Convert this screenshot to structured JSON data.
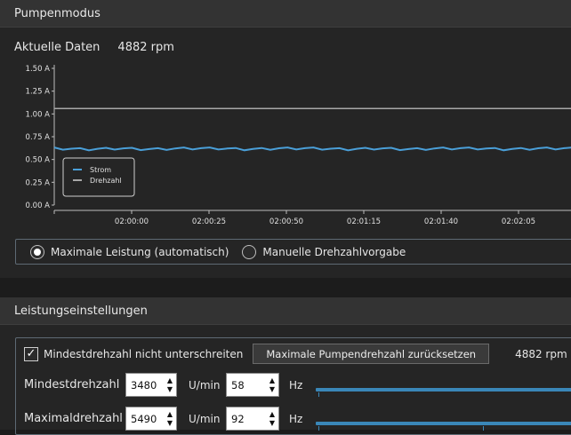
{
  "pump_panel": {
    "title": "Pumpenmodus",
    "current_label": "Aktuelle Daten",
    "current_value": "4882 rpm",
    "mode_options": [
      {
        "label": "Maximale Leistung (automatisch)",
        "selected": true
      },
      {
        "label": "Manuelle Drehzahlvorgabe",
        "selected": false
      }
    ]
  },
  "chart_data": {
    "type": "line",
    "x": [
      "01:59:40",
      "01:59:50",
      "02:00:00",
      "02:00:10",
      "02:00:20",
      "02:00:30",
      "02:00:40",
      "02:00:50",
      "02:01:00",
      "02:01:10",
      "02:01:20",
      "02:01:30",
      "02:01:40",
      "02:01:50",
      "02:02:00",
      "02:02:10",
      "02:02:20"
    ],
    "x_tick_labels": [
      "02:00:00",
      "02:00:25",
      "02:00:50",
      "02:01:15",
      "02:01:40",
      "02:02:05"
    ],
    "y_tick_labels": [
      "0.00 A",
      "0.25 A",
      "0.50 A",
      "0.75 A",
      "1.00 A",
      "1.25 A",
      "1.50 A"
    ],
    "ylim": [
      0,
      1.5
    ],
    "series": [
      {
        "name": "Strom",
        "color": "#4a9fd8",
        "values": [
          0.62,
          0.61,
          0.62,
          0.61,
          0.62,
          0.62,
          0.61,
          0.62,
          0.62,
          0.61,
          0.62,
          0.61,
          0.62,
          0.62,
          0.61,
          0.62,
          0.62
        ]
      },
      {
        "name": "Drehzahl",
        "color": "#a8a8a8",
        "values": [
          1.06,
          1.06,
          1.06,
          1.06,
          1.06,
          1.06,
          1.06,
          1.06,
          1.06,
          1.06,
          1.06,
          1.06,
          1.06,
          1.06,
          1.06,
          1.06,
          1.06
        ]
      }
    ],
    "legend_position": "bottom-left",
    "grid": false
  },
  "power_panel": {
    "title": "Leistungseinstellungen",
    "min_check_label": "Mindestdrehzahl nicht unterschreiten",
    "min_check_checked": true,
    "reset_button": "Maximale Pumpendrehzahl zurücksetzen",
    "max_rpm_value": "4882 rpm",
    "min_row": {
      "label": "Mindestdrehzahl",
      "rpm": "3480",
      "rpm_unit": "U/min",
      "hz": "58",
      "hz_unit": "Hz"
    },
    "max_row": {
      "label": "Maximaldrehzahl",
      "rpm": "5490",
      "rpm_unit": "U/min",
      "hz": "92",
      "hz_unit": "Hz"
    }
  }
}
